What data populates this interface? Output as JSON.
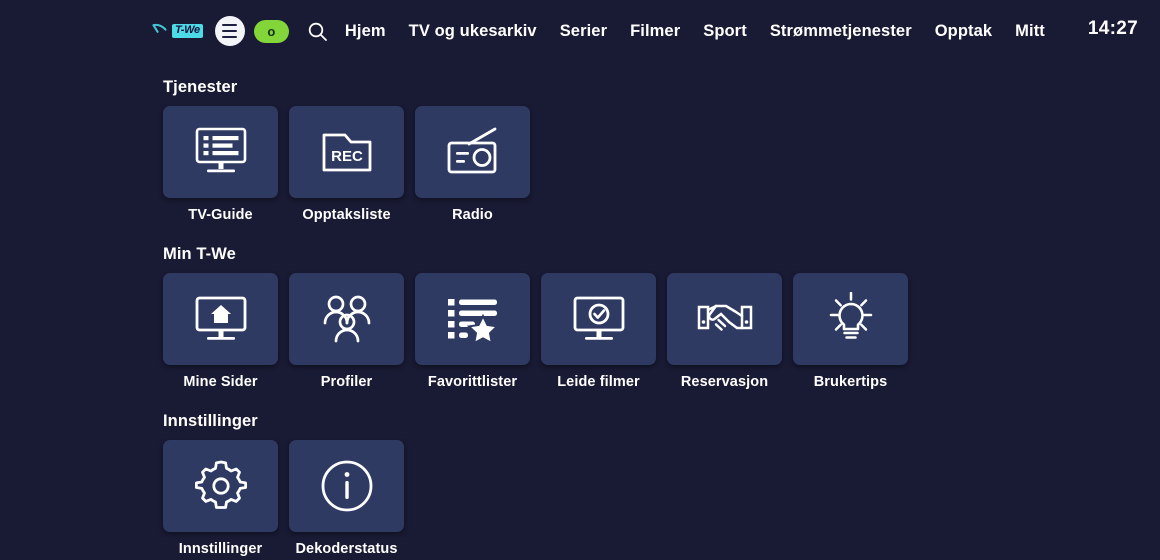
{
  "topnav": {
    "logo": {
      "icon": "telenor-swoosh-icon",
      "badge_text": "T-We"
    },
    "menu_icon": "hamburger-menu-icon",
    "toggle": {
      "icon": "power-toggle-icon",
      "knob_label": "o",
      "color": "#82d639"
    },
    "search_icon": "search-icon",
    "items": [
      {
        "label": "Hjem"
      },
      {
        "label": "TV og ukesarkiv"
      },
      {
        "label": "Serier"
      },
      {
        "label": "Filmer"
      },
      {
        "label": "Sport"
      },
      {
        "label": "Strømmetjenester"
      },
      {
        "label": "Opptak"
      },
      {
        "label": "Mitt"
      }
    ],
    "clock": "14:27"
  },
  "sections": [
    {
      "title": "Tjenester",
      "tiles": [
        {
          "label": "TV-Guide",
          "icon": "tv-guide-icon"
        },
        {
          "label": "Opptaksliste",
          "icon": "rec-folder-icon"
        },
        {
          "label": "Radio",
          "icon": "radio-icon"
        }
      ]
    },
    {
      "title": "Min T-We",
      "tiles": [
        {
          "label": "Mine Sider",
          "icon": "monitor-home-icon"
        },
        {
          "label": "Profiler",
          "icon": "profiles-people-icon"
        },
        {
          "label": "Favorittlister",
          "icon": "list-star-icon"
        },
        {
          "label": "Leide filmer",
          "icon": "monitor-check-icon"
        },
        {
          "label": "Reservasjon",
          "icon": "handshake-icon"
        },
        {
          "label": "Brukertips",
          "icon": "lightbulb-icon"
        }
      ]
    },
    {
      "title": "Innstillinger",
      "tiles": [
        {
          "label": "Innstillinger",
          "icon": "gear-icon"
        },
        {
          "label": "Dekoderstatus",
          "icon": "info-circle-icon"
        }
      ]
    }
  ],
  "colors": {
    "background": "#191a33",
    "tile": "#2e3a61",
    "accent_green": "#82d639",
    "logo_cyan": "#4ddbe8",
    "text": "#ffffff"
  }
}
